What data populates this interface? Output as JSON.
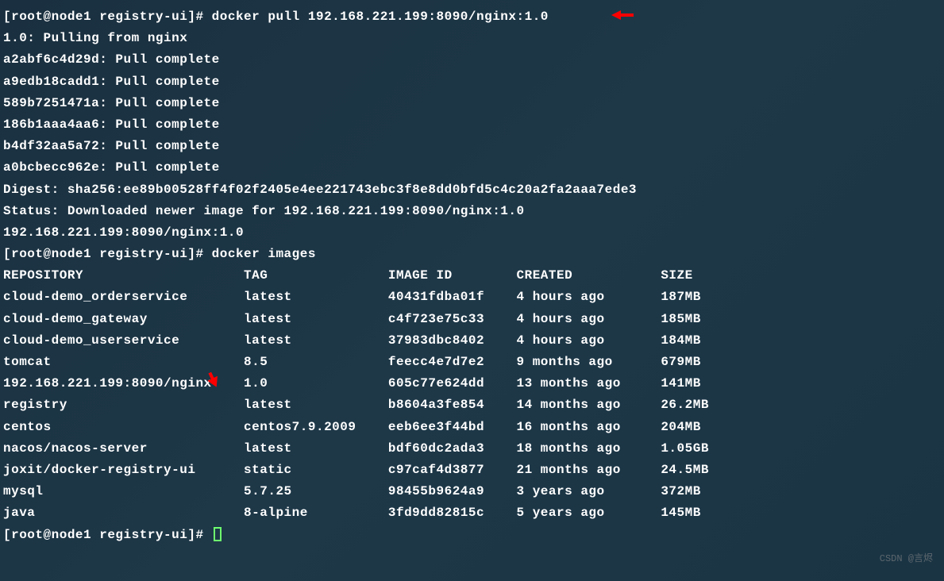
{
  "prompt1": "[root@node1 registry-ui]# ",
  "command1": "docker pull 192.168.221.199:8090/nginx:1.0",
  "pull_output": [
    "1.0: Pulling from nginx",
    "a2abf6c4d29d: Pull complete",
    "a9edb18cadd1: Pull complete",
    "589b7251471a: Pull complete",
    "186b1aaa4aa6: Pull complete",
    "b4df32aa5a72: Pull complete",
    "a0bcbecc962e: Pull complete",
    "Digest: sha256:ee89b00528ff4f02f2405e4ee221743ebc3f8e8dd0bfd5c4c20a2fa2aaa7ede3",
    "Status: Downloaded newer image for 192.168.221.199:8090/nginx:1.0",
    "192.168.221.199:8090/nginx:1.0"
  ],
  "prompt2": "[root@node1 registry-ui]# ",
  "command2": "docker images",
  "headers": {
    "repository": "REPOSITORY",
    "tag": "TAG",
    "image_id": "IMAGE ID",
    "created": "CREATED",
    "size": "SIZE"
  },
  "images": [
    {
      "repository": "cloud-demo_orderservice",
      "tag": "latest",
      "image_id": "40431fdba01f",
      "created": "4 hours ago",
      "size": "187MB"
    },
    {
      "repository": "cloud-demo_gateway",
      "tag": "latest",
      "image_id": "c4f723e75c33",
      "created": "4 hours ago",
      "size": "185MB"
    },
    {
      "repository": "cloud-demo_userservice",
      "tag": "latest",
      "image_id": "37983dbc8402",
      "created": "4 hours ago",
      "size": "184MB"
    },
    {
      "repository": "tomcat",
      "tag": "8.5",
      "image_id": "feecc4e7d7e2",
      "created": "9 months ago",
      "size": "679MB"
    },
    {
      "repository": "192.168.221.199:8090/nginx",
      "tag": "1.0",
      "image_id": "605c77e624dd",
      "created": "13 months ago",
      "size": "141MB"
    },
    {
      "repository": "registry",
      "tag": "latest",
      "image_id": "b8604a3fe854",
      "created": "14 months ago",
      "size": "26.2MB"
    },
    {
      "repository": "centos",
      "tag": "centos7.9.2009",
      "image_id": "eeb6ee3f44bd",
      "created": "16 months ago",
      "size": "204MB"
    },
    {
      "repository": "nacos/nacos-server",
      "tag": "latest",
      "image_id": "bdf60dc2ada3",
      "created": "18 months ago",
      "size": "1.05GB"
    },
    {
      "repository": "joxit/docker-registry-ui",
      "tag": "static",
      "image_id": "c97caf4d3877",
      "created": "21 months ago",
      "size": "24.5MB"
    },
    {
      "repository": "mysql",
      "tag": "5.7.25",
      "image_id": "98455b9624a9",
      "created": "3 years ago",
      "size": "372MB"
    },
    {
      "repository": "java",
      "tag": "8-alpine",
      "image_id": "3fd9dd82815c",
      "created": "5 years ago",
      "size": "145MB"
    }
  ],
  "prompt3": "[root@node1 registry-ui]# ",
  "watermark": "CSDN @言烬"
}
